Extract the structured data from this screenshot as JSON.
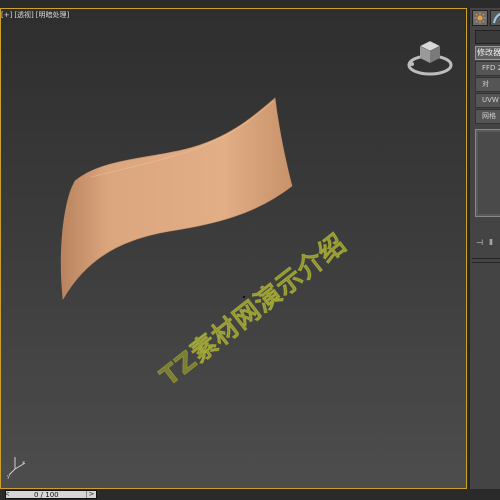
{
  "viewport": {
    "labels": [
      "[+]",
      "[透视]",
      "[明暗处理]"
    ]
  },
  "watermark": "TZ素材网演示介绍",
  "command_panel": {
    "tabs": [
      {
        "icon": "create-sun-icon",
        "active": true
      },
      {
        "icon": "modify-arc-icon",
        "active": false
      }
    ],
    "modifier_list": "修改器",
    "stack": [
      "FFD 2",
      "对",
      "UVW",
      "网格"
    ]
  },
  "timeline": {
    "position": "0 / 100",
    "prev_arrow": "<",
    "next_arrow": ">"
  },
  "colors": {
    "viewport_border": "#c9a227",
    "surface": "#d9a47c",
    "watermark": "#aaaf28"
  }
}
